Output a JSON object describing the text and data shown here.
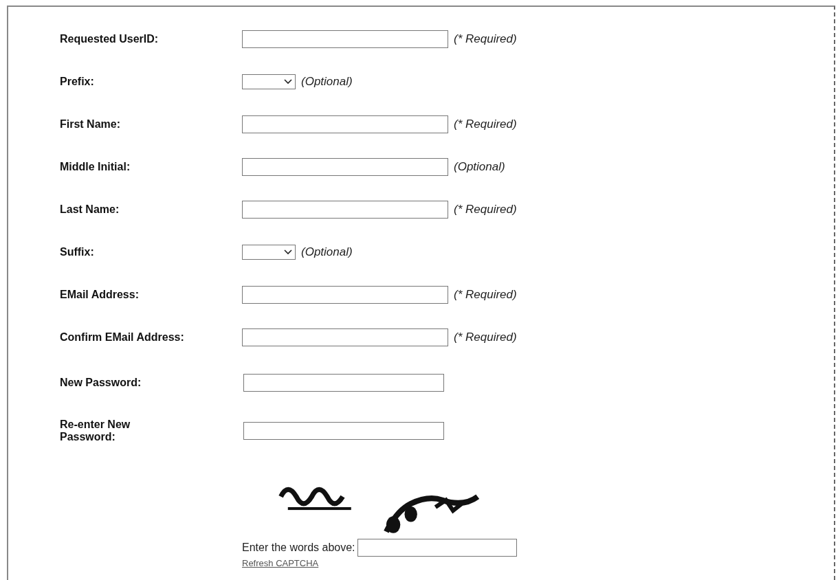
{
  "fields": [
    {
      "kind": "text",
      "label": "Requested UserID:",
      "note": "(* Required)"
    },
    {
      "kind": "select",
      "label": "Prefix:",
      "note": "(Optional)"
    },
    {
      "kind": "text",
      "label": "First Name:",
      "note": "(* Required)"
    },
    {
      "kind": "text",
      "label": "Middle Initial:",
      "note": "(Optional)"
    },
    {
      "kind": "text",
      "label": "Last Name:",
      "note": "(* Required)"
    },
    {
      "kind": "select",
      "label": "Suffix:",
      "note": "(Optional)"
    },
    {
      "kind": "text",
      "label": "EMail Address:",
      "note": "(* Required)"
    },
    {
      "kind": "text",
      "label": "Confirm EMail Address:",
      "note": "(* Required)"
    },
    {
      "kind": "password",
      "label": "New Password:"
    },
    {
      "kind": "password",
      "label": "Re-enter New Password:"
    }
  ],
  "captcha": {
    "prompt": "Enter the words above:",
    "refresh_link": "Refresh CAPTCHA"
  }
}
